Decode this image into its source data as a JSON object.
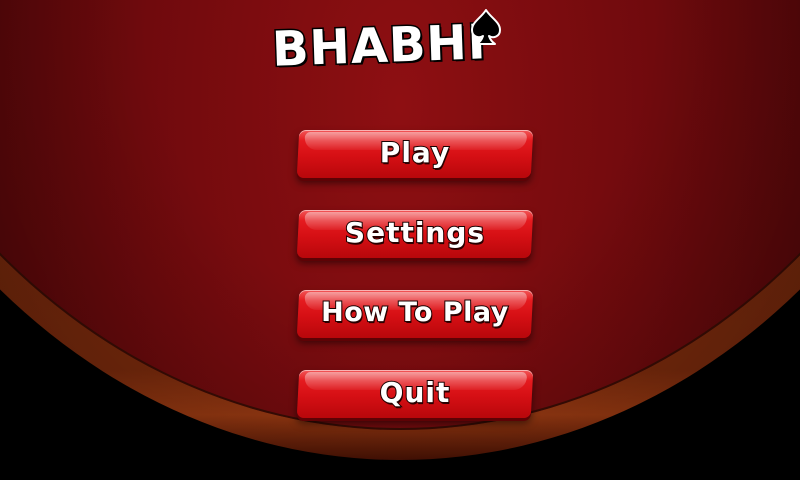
{
  "logo": {
    "title": "BHABHI",
    "icon": "spade-icon"
  },
  "menu": {
    "play_label": "Play",
    "settings_label": "Settings",
    "how_to_play_label": "How To Play",
    "quit_label": "Quit"
  },
  "colors": {
    "felt": "#7a0b0e",
    "rail": "#7a2a0c",
    "button": "#d50f14",
    "button_text": "#ffffff"
  }
}
